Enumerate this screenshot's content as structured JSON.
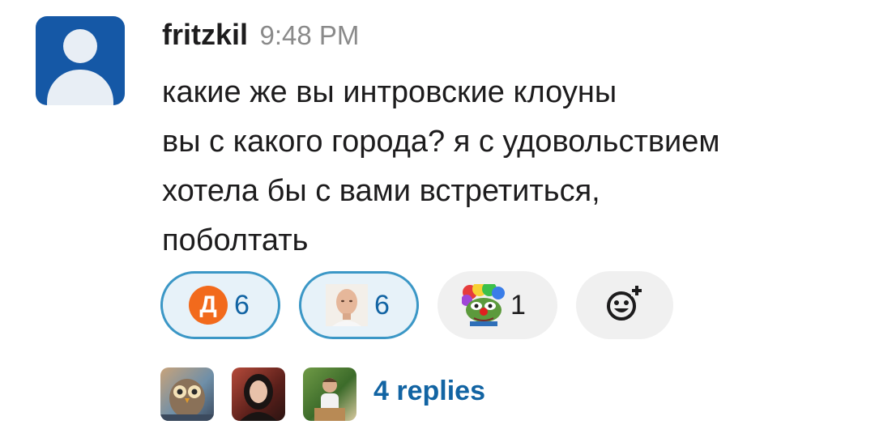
{
  "message": {
    "username": "fritzkil",
    "time": "9:48 PM",
    "lines": [
      "какие же вы интровские клоуны",
      "вы с какого города? я с удовольствием",
      "хотела бы с вами встретиться,",
      "поболтать"
    ]
  },
  "reactions": [
    {
      "emoji": "orange-d-logo",
      "glyph": "Д",
      "count": "6",
      "selected": true
    },
    {
      "emoji": "bald-man-photo",
      "count": "6",
      "selected": true
    },
    {
      "emoji": "pepe-clown",
      "count": "1",
      "selected": false
    }
  ],
  "add_reaction": {
    "icon": "smiley-plus-icon"
  },
  "thread": {
    "replies_label": "4 replies",
    "avatars": [
      "owl-avatar",
      "woman-avatar",
      "man-avatar"
    ]
  },
  "colors": {
    "avatar_bg": "#1558a6",
    "link": "#1264a3",
    "selected_border": "#3b97c6",
    "selected_bg": "#e7f2f9",
    "d_logo": "#f26a1c"
  }
}
